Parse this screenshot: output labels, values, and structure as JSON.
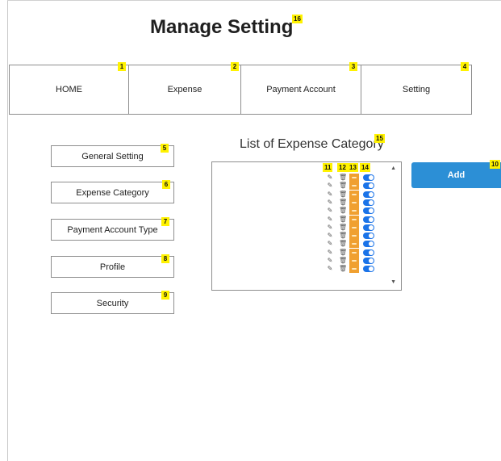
{
  "page": {
    "title": "Manage Setting"
  },
  "nav": {
    "tabs": [
      {
        "label": "HOME",
        "badge": "1"
      },
      {
        "label": "Expense",
        "badge": "2"
      },
      {
        "label": "Payment Account",
        "badge": "3"
      },
      {
        "label": "Setting",
        "badge": "4"
      }
    ]
  },
  "sidebar": {
    "items": [
      {
        "label": "General Setting",
        "badge": "5"
      },
      {
        "label": "Expense Category",
        "badge": "6"
      },
      {
        "label": "Payment Account Type",
        "badge": "7"
      },
      {
        "label": "Profile",
        "badge": "8"
      },
      {
        "label": "Security",
        "badge": "9"
      }
    ]
  },
  "list": {
    "title": "List of Expense Category",
    "title_badge": "15",
    "column_badges": {
      "edit": "11",
      "delete": "12",
      "view": "13",
      "toggle": "14"
    },
    "row_count": 12,
    "row_icons": {
      "edit": "pencil-icon",
      "delete": "trash-icon",
      "view": "view-icon",
      "toggle": "toggle-switch"
    }
  },
  "actions": {
    "add_label": "Add",
    "add_badge": "10"
  },
  "page_badge": "16",
  "colors": {
    "toggle": "#1a73e8",
    "view": "#f0a030",
    "add": "#2c8fd6",
    "badge": "#fff200"
  }
}
